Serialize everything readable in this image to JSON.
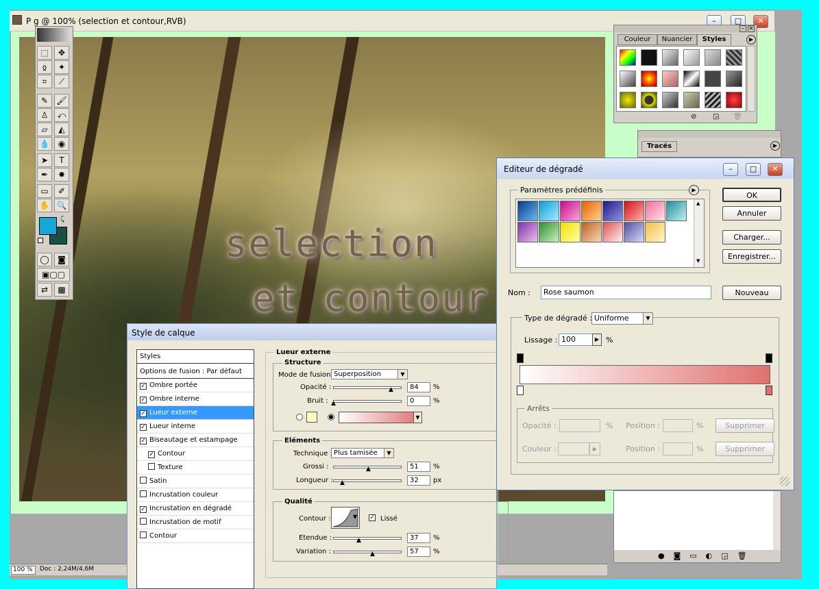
{
  "document": {
    "title": "P            g @ 100% (selection  et contour,RVB)",
    "text_line1": "selection",
    "text_line2": "et contour"
  },
  "status_bar": {
    "zoom": "100 %",
    "doc_size": "Doc : 2,24M/4,6M"
  },
  "styles_panel": {
    "tabs": [
      "Couleur",
      "Nuancier",
      "Styles"
    ],
    "active_tab": "Styles"
  },
  "paths_panel": {
    "tab": "Tracés"
  },
  "layer_style_dialog": {
    "title": "Style de calque",
    "list_header": "Styles",
    "items": [
      {
        "label": "Options de fusion : Par défaut",
        "checkbox": false,
        "checked": false
      },
      {
        "label": "Ombre portée",
        "checkbox": true,
        "checked": true
      },
      {
        "label": "Ombre interne",
        "checkbox": true,
        "checked": true
      },
      {
        "label": "Lueur externe",
        "checkbox": true,
        "checked": true,
        "selected": true
      },
      {
        "label": "Lueur interne",
        "checkbox": true,
        "checked": true
      },
      {
        "label": "Biseautage et estampage",
        "checkbox": true,
        "checked": true
      },
      {
        "label": "Contour",
        "checkbox": true,
        "checked": true,
        "indent": true
      },
      {
        "label": "Texture",
        "checkbox": true,
        "checked": false,
        "indent": true
      },
      {
        "label": "Satin",
        "checkbox": true,
        "checked": false
      },
      {
        "label": "Incrustation couleur",
        "checkbox": true,
        "checked": false
      },
      {
        "label": "Incrustation en dégradé",
        "checkbox": true,
        "checked": true
      },
      {
        "label": "Incrustation de motif",
        "checkbox": true,
        "checked": false
      },
      {
        "label": "Contour",
        "checkbox": true,
        "checked": false
      }
    ],
    "section_title": "Lueur externe",
    "structure": {
      "title": "Structure",
      "blend_mode_label": "Mode de fusion :",
      "blend_mode": "Superposition",
      "opacity_label": "Opacité :",
      "opacity": "84",
      "opacity_fraction": 0.84,
      "noise_label": "Bruit :",
      "noise": "0",
      "noise_fraction": 0.0,
      "unit": "%",
      "color_swatch": "#ffffc0"
    },
    "elements": {
      "title": "Eléments",
      "technique_label": "Technique :",
      "technique": "Plus tamisée",
      "spread_label": "Grossi :",
      "spread": "51",
      "spread_fraction": 0.51,
      "spread_unit": "%",
      "size_label": "Longueur :",
      "size": "32",
      "size_fraction": 0.13,
      "size_unit": "px"
    },
    "quality": {
      "title": "Qualité",
      "contour_label": "Contour :",
      "antialias_label": "Lissé",
      "antialias_checked": true,
      "range_label": "Etendue :",
      "range": "37",
      "range_fraction": 0.37,
      "jitter_label": "Variation :",
      "jitter": "57",
      "jitter_fraction": 0.57,
      "unit": "%"
    }
  },
  "gradient_editor": {
    "title": "Editeur de dégradé",
    "presets_label": "Paramètres prédéfinis",
    "buttons": {
      "ok": "OK",
      "cancel": "Annuler",
      "load": "Charger...",
      "save": "Enregistrer...",
      "new": "Nouveau",
      "delete": "Supprimer"
    },
    "name_label": "Nom :",
    "name_value": "Rose saumon",
    "type_label": "Type de dégradé :",
    "type_value": "Uniforme",
    "smoothness_label": "Lissage :",
    "smoothness_value": "100",
    "smoothness_unit": "%",
    "stops_title": "Arrêts",
    "opacity_label": "Opacité :",
    "color_label": "Couleur :",
    "position_label": "Position :",
    "percent": "%",
    "gradient_start": "#ffffff",
    "gradient_end": "#e07070"
  },
  "colors": {
    "foreground": "#18a8d8",
    "background": "#185048",
    "selection": "#3399ff"
  }
}
